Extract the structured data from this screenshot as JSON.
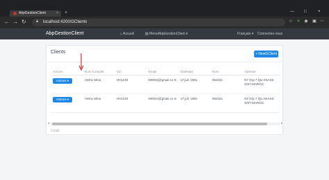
{
  "browser": {
    "tab_title": "AbpGestionClient",
    "close_glyph": "×",
    "new_tab_glyph": "+",
    "url": "localhost:4200/GClients",
    "window_controls": [
      "—",
      "□",
      "×"
    ]
  },
  "app": {
    "brand": "AbpGestionClient",
    "nav": {
      "home": "Accueil",
      "menu": "MenuAbpGestionClient",
      "language": "Français",
      "login": "Connectez-vous"
    }
  },
  "clients": {
    "title": "Clients",
    "new_button": "+ NewGClient",
    "columns": [
      "Actions",
      "Nom Complet",
      "Cin",
      "Email",
      "DateNais",
      "Nom",
      "Adresse"
    ],
    "action_label": "Actions ▾",
    "rows": [
      {
        "nom_complet": "AMAL Mina",
        "cin": "HH1234",
        "email": "MOMA@gmail.co m",
        "date_nais": "17 juil. 1981",
        "nom": "654321",
        "adresse": "N7 Grp 7 QU ANASS SAFI MAROC"
      },
      {
        "nom_complet": "AMAL Mina",
        "cin": "HH1234",
        "email": "MOMA@gmail.co m",
        "date_nais": "17 juil. 1981",
        "nom": "654321",
        "adresse": "N7 Grp 7 QU ANASS SAFI MAROC"
      }
    ],
    "total": "2 total"
  },
  "colors": {
    "accent": "#1e88e5",
    "nav_bg": "#343a40",
    "annotation_arrow": "#d32f2f"
  },
  "icons": [
    "back-icon",
    "forward-icon",
    "refresh-icon",
    "home-icon",
    "lock-icon",
    "star-icon",
    "extensions-icon",
    "profile-icon",
    "menu-dots-icon",
    "red-arrow-annotation"
  ]
}
